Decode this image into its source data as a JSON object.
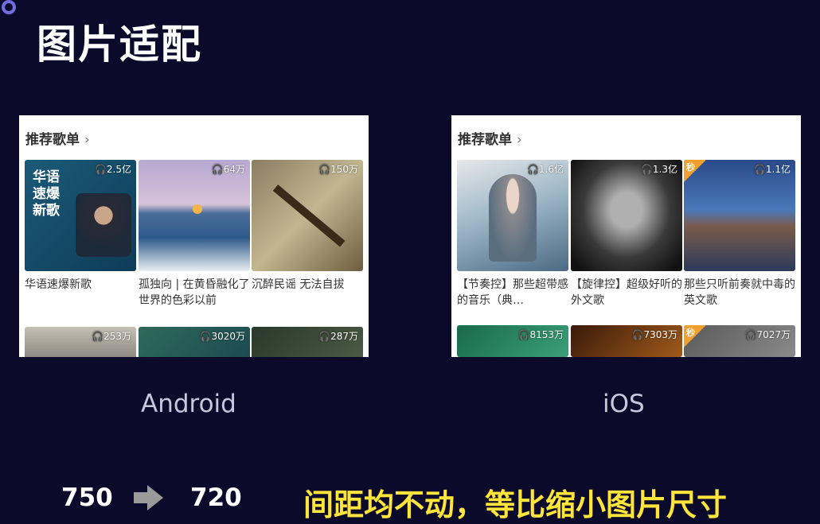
{
  "slide": {
    "title": "图片适配"
  },
  "android": {
    "header": "推荐歌单",
    "chevron": "›",
    "platform_label": "Android",
    "cards": [
      {
        "count": "2.5亿",
        "title": "华语速爆新歌",
        "cover_text": "华语\n速爆\n新歌"
      },
      {
        "count": "64万",
        "title": "孤独向 | 在黄昏融化了世界的色彩以前"
      },
      {
        "count": "150万",
        "title": "沉醉民谣 无法自拔"
      },
      {
        "count": "253万",
        "title": ""
      },
      {
        "count": "3020万",
        "title": ""
      },
      {
        "count": "287万",
        "title": ""
      }
    ]
  },
  "ios": {
    "header": "推荐歌单",
    "chevron": "›",
    "platform_label": "iOS",
    "badge_text": "秒",
    "cards": [
      {
        "count": "1.6亿",
        "title": "【节奏控】那些超带感的音乐（典…"
      },
      {
        "count": "1.3亿",
        "title": "【旋律控】超级好听的外文歌"
      },
      {
        "count": "1.1亿",
        "title": "那些只听前奏就中毒的英文歌"
      },
      {
        "count": "8153万",
        "title": ""
      },
      {
        "count": "7303万",
        "title": ""
      },
      {
        "count": "7027万",
        "title": ""
      }
    ]
  },
  "footer": {
    "from": "750",
    "to": "720",
    "tagline": "间距均不动，等比缩小图片尺寸"
  },
  "colors": {
    "background": "#0c0a2a",
    "accent": "#ffe53a"
  }
}
